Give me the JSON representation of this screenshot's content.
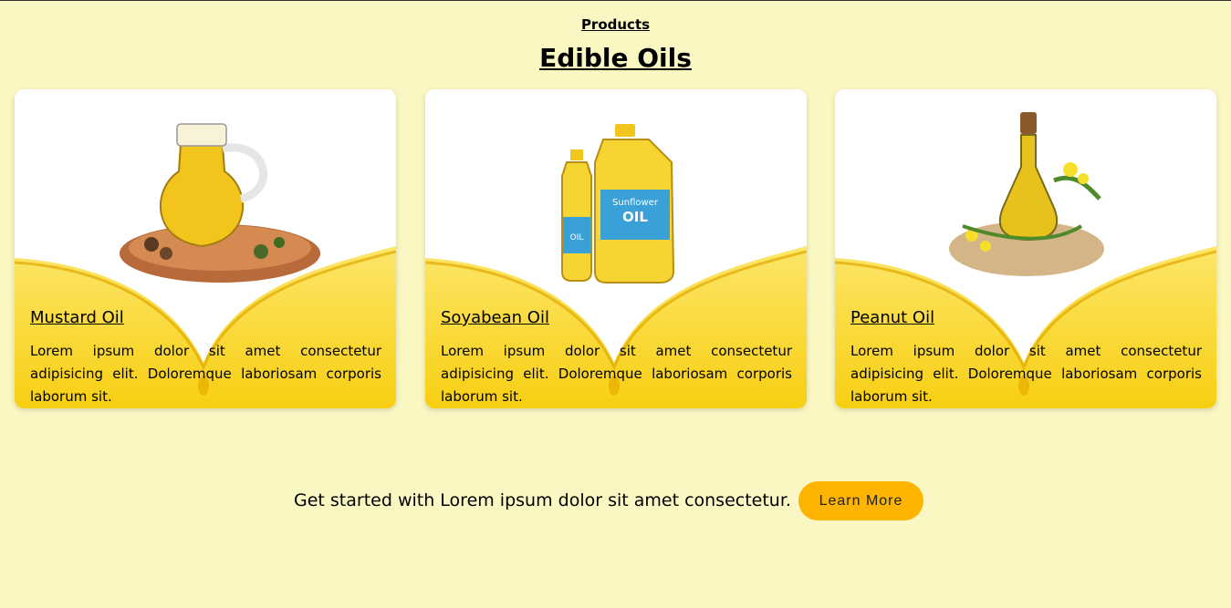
{
  "header": {
    "eyebrow": "Products",
    "title": "Edible Oils"
  },
  "products": [
    {
      "name": "Mustard Oil",
      "description": "Lorem ipsum dolor sit amet consectetur adipisicing elit. Doloremque laboriosam corporis laborum sit.",
      "image_icon": "oil-jug-icon"
    },
    {
      "name": "Soyabean Oil",
      "description": "Lorem ipsum dolor sit amet consectetur adipisicing elit. Doloremque laboriosam corporis laborum sit.",
      "image_icon": "oil-bottles-icon",
      "bottle_labels": {
        "big": "Sunflower",
        "big_sub": "OIL",
        "small": "OIL"
      }
    },
    {
      "name": "Peanut Oil",
      "description": "Lorem ipsum dolor sit amet consectetur adipisicing elit. Doloremque laboriosam corporis laborum sit.",
      "image_icon": "oil-flask-icon"
    }
  ],
  "cta": {
    "text": "Get started with Lorem ipsum dolor sit amet consectetur.",
    "button_label": "Learn More"
  },
  "colors": {
    "page_background": "#faf7c2",
    "card_yellow": "#fbd52a",
    "button": "#fdb402"
  }
}
